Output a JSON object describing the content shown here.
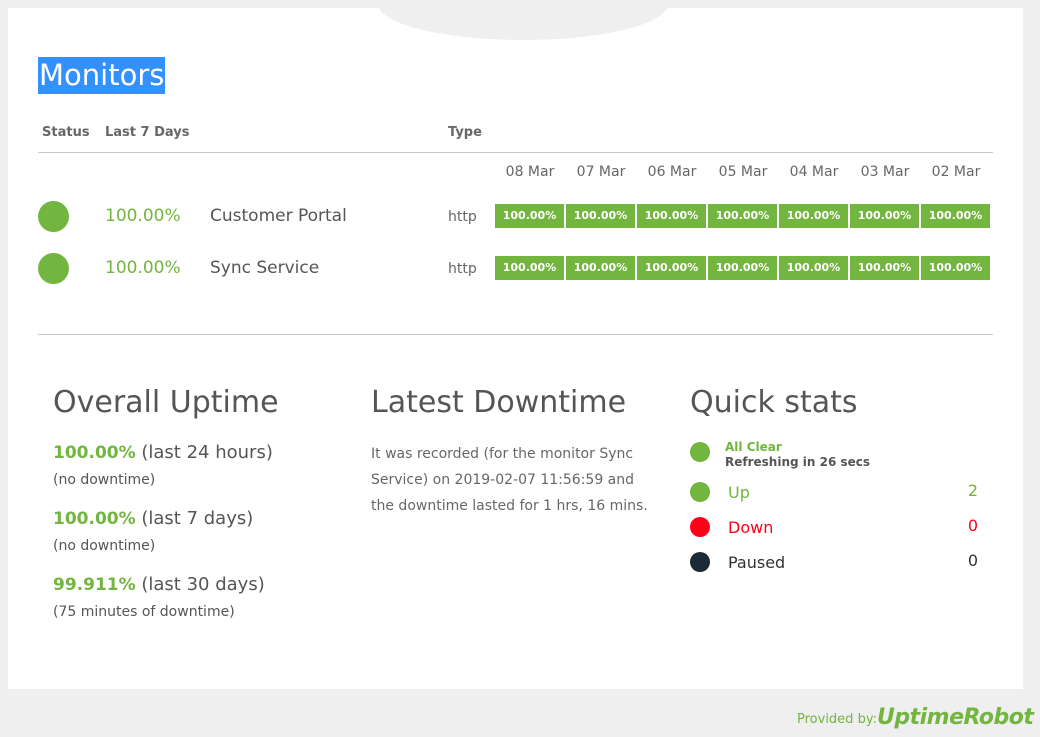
{
  "page_title": "Monitors",
  "columns": {
    "status": "Status",
    "last7": "Last 7 Days",
    "type": "Type"
  },
  "dates": [
    "08 Mar",
    "07 Mar",
    "06 Mar",
    "05 Mar",
    "04 Mar",
    "03 Mar",
    "02 Mar"
  ],
  "monitors": [
    {
      "uptime": "100.00%",
      "name": "Customer Portal",
      "type": "http",
      "daily": [
        "100.00%",
        "100.00%",
        "100.00%",
        "100.00%",
        "100.00%",
        "100.00%",
        "100.00%"
      ]
    },
    {
      "uptime": "100.00%",
      "name": "Sync Service",
      "type": "http",
      "daily": [
        "100.00%",
        "100.00%",
        "100.00%",
        "100.00%",
        "100.00%",
        "100.00%",
        "100.00%"
      ]
    }
  ],
  "overall": {
    "title": "Overall Uptime",
    "items": [
      {
        "value": "100.00%",
        "period": "(last 24 hours)",
        "note": "(no downtime)"
      },
      {
        "value": "100.00%",
        "period": "(last 7 days)",
        "note": "(no downtime)"
      },
      {
        "value": "99.911%",
        "period": "(last 30 days)",
        "note": "(75 minutes of downtime)"
      }
    ]
  },
  "latest": {
    "title": "Latest Downtime",
    "text": "It was recorded (for the monitor Sync Service) on 2019-02-07 11:56:59 and the downtime lasted for 1 hrs, 16 mins."
  },
  "quick": {
    "title": "Quick stats",
    "status": "All Clear",
    "refresh": "Refreshing in 26 secs",
    "up_label": "Up",
    "up_count": "2",
    "down_label": "Down",
    "down_count": "0",
    "paused_label": "Paused",
    "paused_count": "0"
  },
  "colors": {
    "up": "#72b53f",
    "down": "#ff0019",
    "paused": "#1c2a35",
    "highlight": "#3390ff"
  },
  "footer": {
    "provided_by": "Provided by:",
    "brand": "UptimeRobot"
  }
}
